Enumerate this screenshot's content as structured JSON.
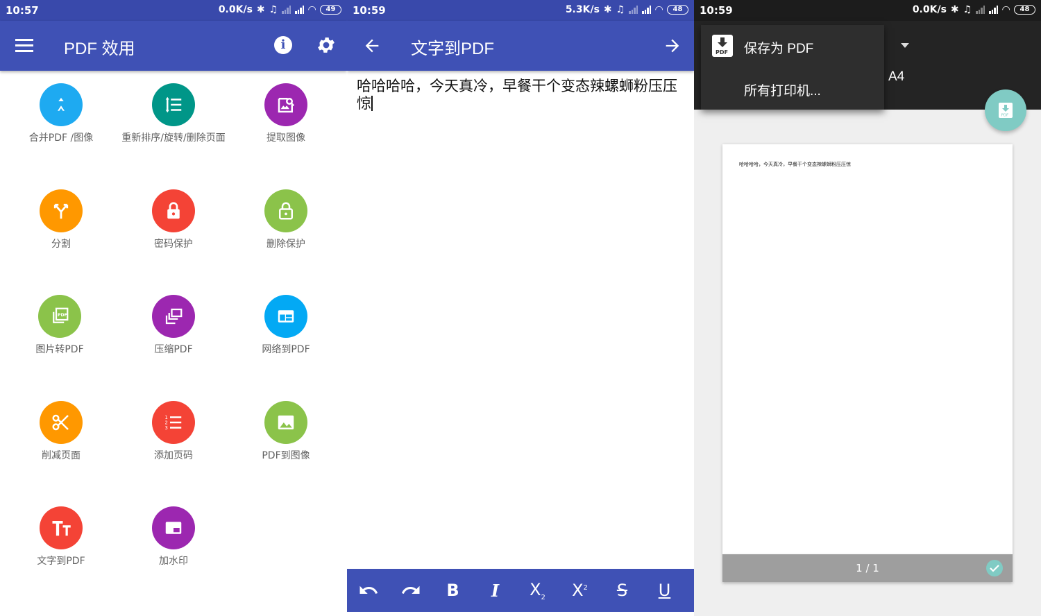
{
  "screen1": {
    "status": {
      "time": "10:57",
      "speed": "0.0K/s",
      "battery": "49"
    },
    "title": "PDF 效用",
    "tools": [
      {
        "label": "合并PDF /图像",
        "color": "#1eaaf1"
      },
      {
        "label": "重新排序/旋转/删除页面",
        "color": "#009688"
      },
      {
        "label": "提取图像",
        "color": "#9c27b0"
      },
      {
        "label": "分割",
        "color": "#ff9800"
      },
      {
        "label": "密码保护",
        "color": "#f44336"
      },
      {
        "label": "删除保护",
        "color": "#8bc34a"
      },
      {
        "label": "图片转PDF",
        "color": "#8bc34a"
      },
      {
        "label": "压缩PDF",
        "color": "#9c27b0"
      },
      {
        "label": "网络到PDF",
        "color": "#03a9f4"
      },
      {
        "label": "削减页面",
        "color": "#ff9800"
      },
      {
        "label": "添加页码",
        "color": "#f44336"
      },
      {
        "label": "PDF到图像",
        "color": "#8bc34a"
      },
      {
        "label": "文字到PDF",
        "color": "#f44336"
      },
      {
        "label": "加水印",
        "color": "#9c27b0"
      }
    ]
  },
  "screen2": {
    "status": {
      "time": "10:59",
      "speed": "5.3K/s",
      "battery": "48"
    },
    "title": "文字到PDF",
    "text_line1": "哈哈哈哈，今天真冷，早餐干个变态辣螺蛳粉压压",
    "text_line2": "惊",
    "toolbar": [
      "undo-icon",
      "redo-icon",
      "bold-icon",
      "italic-icon",
      "subscript-icon",
      "superscript-icon",
      "strikethrough-icon",
      "underline-icon"
    ]
  },
  "screen3": {
    "status": {
      "time": "10:59",
      "speed": "0.0K/s",
      "battery": "48"
    },
    "option_save_pdf": "保存为 PDF",
    "option_all_printers": "所有打印机...",
    "paper_size": "A4",
    "page_text": "哈哈哈哈，今天真冷，早餐干个变态辣螺蛳粉压压惊",
    "page_count": "1 / 1"
  }
}
